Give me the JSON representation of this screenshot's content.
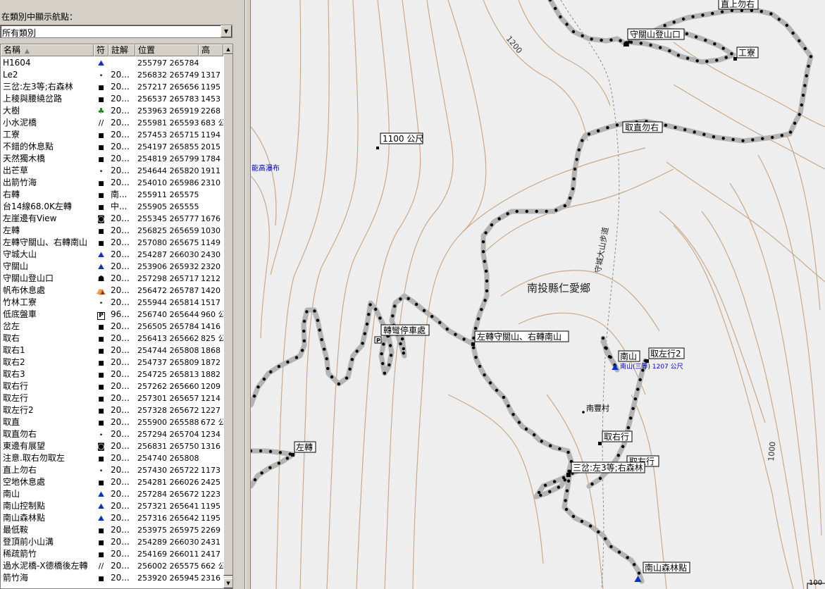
{
  "panel": {
    "filter_label": "在類別中顯示航點：",
    "category_value": "所有類別",
    "columns": {
      "name": "名稱",
      "symbol": "符",
      "comment": "註解",
      "position": "位置",
      "altitude": "高"
    }
  },
  "waypoints": [
    {
      "name": "H1604",
      "symbol": "mountain-icon",
      "comment": "",
      "position": "255797 2657845",
      "altitude": ""
    },
    {
      "name": "Le2",
      "symbol": "dot-icon",
      "comment": "20...",
      "position": "256832 2657498",
      "altitude": "1317"
    },
    {
      "name": "三岔:左3等;右森林",
      "symbol": "square-icon",
      "comment": "20...",
      "position": "257217 2656564",
      "altitude": "1195"
    },
    {
      "name": "上稜與腰繞岔路",
      "symbol": "square-icon",
      "comment": "20...",
      "position": "256537 2657831",
      "altitude": "1453"
    },
    {
      "name": "大樹",
      "symbol": "tree-icon",
      "comment": "20...",
      "position": "253963 2659193",
      "altitude": "2268"
    },
    {
      "name": "小水泥橋",
      "symbol": "bridge-icon",
      "comment": "20...",
      "position": "255981 2655939",
      "altitude": "683 公"
    },
    {
      "name": "工寮",
      "symbol": "square-icon",
      "comment": "20...",
      "position": "257453 2657151",
      "altitude": "1194"
    },
    {
      "name": "不錯的休息點",
      "symbol": "square-icon",
      "comment": "20...",
      "position": "254197 2658556",
      "altitude": "2015"
    },
    {
      "name": "天然獨木橋",
      "symbol": "square-icon",
      "comment": "20...",
      "position": "254819 2657993",
      "altitude": "1784"
    },
    {
      "name": "出芒草",
      "symbol": "dot-icon",
      "comment": "20...",
      "position": "254644 2658204",
      "altitude": "1911"
    },
    {
      "name": "出箭竹海",
      "symbol": "square-icon",
      "comment": "20...",
      "position": "254010 2659866",
      "altitude": "2310"
    },
    {
      "name": "右轉",
      "symbol": "square-icon",
      "comment": "南...",
      "position": "255911 2655751",
      "altitude": ""
    },
    {
      "name": "台14線68.0K左轉",
      "symbol": "square-icon",
      "comment": "中...",
      "position": "255905 2655559",
      "altitude": ""
    },
    {
      "name": "左崖邊有View",
      "symbol": "camera-icon",
      "comment": "20...",
      "position": "255345 2657775",
      "altitude": "1676"
    },
    {
      "name": "左轉",
      "symbol": "square-icon",
      "comment": "20...",
      "position": "256825 2656593",
      "altitude": "1030"
    },
    {
      "name": "左轉守關山、右轉南山",
      "symbol": "square-icon",
      "comment": "20...",
      "position": "257080 2656750",
      "altitude": "1149"
    },
    {
      "name": "守城大山",
      "symbol": "mountain-icon",
      "comment": "20...",
      "position": "254287 2660304",
      "altitude": "2430"
    },
    {
      "name": "守關山",
      "symbol": "mountain-icon",
      "comment": "20...",
      "position": "253906 2659322",
      "altitude": "2320"
    },
    {
      "name": "守關山登山口",
      "symbol": "hiker-icon",
      "comment": "20...",
      "position": "257298 2657176",
      "altitude": "1212"
    },
    {
      "name": "帆布休息處",
      "symbol": "tent-icon",
      "comment": "20...",
      "position": "256472 2657877",
      "altitude": "1420"
    },
    {
      "name": "竹林工寮",
      "symbol": "dot-icon",
      "comment": "20...",
      "position": "255944 2658145",
      "altitude": "1517"
    },
    {
      "name": "低底盤車",
      "symbol": "parking-icon",
      "comment": "96...",
      "position": "256740 2656448",
      "altitude": "960 公"
    },
    {
      "name": "岔左",
      "symbol": "square-icon",
      "comment": "20...",
      "position": "256505 2657847",
      "altitude": "1416"
    },
    {
      "name": "取右",
      "symbol": "square-icon",
      "comment": "20...",
      "position": "256413 2656629",
      "altitude": "825 公"
    },
    {
      "name": "取右1",
      "symbol": "square-icon",
      "comment": "20...",
      "position": "254744 2658086",
      "altitude": "1868"
    },
    {
      "name": "取右2",
      "symbol": "square-icon",
      "comment": "20...",
      "position": "254737 2658095",
      "altitude": "1872"
    },
    {
      "name": "取右3",
      "symbol": "square-icon",
      "comment": "20...",
      "position": "254725 2658137",
      "altitude": "1882"
    },
    {
      "name": "取右行",
      "symbol": "square-icon",
      "comment": "20...",
      "position": "257262 2656609",
      "altitude": "1209"
    },
    {
      "name": "取左行",
      "symbol": "square-icon",
      "comment": "20...",
      "position": "257301 2656575",
      "altitude": "1214"
    },
    {
      "name": "取左行2",
      "symbol": "square-icon",
      "comment": "20...",
      "position": "257328 2656725",
      "altitude": "1227"
    },
    {
      "name": "取直",
      "symbol": "square-icon",
      "comment": "20...",
      "position": "255900 2655882",
      "altitude": "672 公"
    },
    {
      "name": "取直勿右",
      "symbol": "dot-icon",
      "comment": "20...",
      "position": "257294 2657046",
      "altitude": "1234"
    },
    {
      "name": "東邊有展望",
      "symbol": "camera-icon",
      "comment": "20...",
      "position": "256831 2657500",
      "altitude": "1316"
    },
    {
      "name": "注意.取右勿取左",
      "symbol": "square-icon",
      "comment": "20...",
      "position": "254740 2658080",
      "altitude": ""
    },
    {
      "name": "直上勿右",
      "symbol": "dot-icon",
      "comment": "20...",
      "position": "257430 2657221",
      "altitude": "1173"
    },
    {
      "name": "空地休息處",
      "symbol": "square-icon",
      "comment": "20...",
      "position": "254281 2660266",
      "altitude": "2425"
    },
    {
      "name": "南山",
      "symbol": "mountain-icon",
      "comment": "20...",
      "position": "257284 2656720",
      "altitude": "1223"
    },
    {
      "name": "南山控制點",
      "symbol": "mountain-icon",
      "comment": "20...",
      "position": "257321 2656418",
      "altitude": "1195"
    },
    {
      "name": "南山森林點",
      "symbol": "mountain-icon",
      "comment": "20...",
      "position": "257316 2656424",
      "altitude": "1195"
    },
    {
      "name": "最低鞍",
      "symbol": "square-icon",
      "comment": "20...",
      "position": "253975 2659757",
      "altitude": "2269"
    },
    {
      "name": "登頂前小山溝",
      "symbol": "square-icon",
      "comment": "20...",
      "position": "254289 2660304",
      "altitude": "2431"
    },
    {
      "name": "稀疏箭竹",
      "symbol": "square-icon",
      "comment": "20...",
      "position": "254169 2660119",
      "altitude": "2417"
    },
    {
      "name": "過水泥橋-X德橋後左轉",
      "symbol": "bridge-icon",
      "comment": "20...",
      "position": "256002 2655754",
      "altitude": "662 公"
    },
    {
      "name": "箭竹海",
      "symbol": "square-icon",
      "comment": "20...",
      "position": "253920 2659453",
      "altitude": "2316"
    }
  ],
  "symbol_glyphs": {
    "mountain-icon": "⛰",
    "dot-icon": "•",
    "square-icon": "■",
    "tree-icon": "♣",
    "bridge-icon": "//",
    "camera-icon": "◙",
    "hiker-icon": "☗",
    "tent-icon": "⛺",
    "parking-icon": "P"
  },
  "map": {
    "labels": {
      "top_right_wp": "直上勿右",
      "trailhead": "守關山登山口",
      "hut": "工寮",
      "straight_no_right": "取直勿右",
      "elev_1100": "1100 公尺",
      "waterfall": "能高瀑布",
      "district": "南投縣仁愛鄉",
      "road": "守城大山步道",
      "junction": "左轉守關山、右轉南山",
      "low_car": "轉彎停車處",
      "nanshan": "南山",
      "take_left2": "取左行2",
      "nanshan_alt": "南山(三等) 1207 公尺",
      "village": "南豐村",
      "take_right": "取右行",
      "take_left": "取左行",
      "fork": "三岔:左3等;右森林",
      "left_turn": "左轉",
      "forest_point": "南山森林點",
      "contour_1200": "1200",
      "contour_1000": "1000",
      "scale": "100"
    },
    "colors": {
      "background": "#eeeeee",
      "contour": "#c8a98c",
      "track_halo": "#b4b4b4",
      "track": "#000000",
      "blue_text": "#0000cc"
    }
  }
}
